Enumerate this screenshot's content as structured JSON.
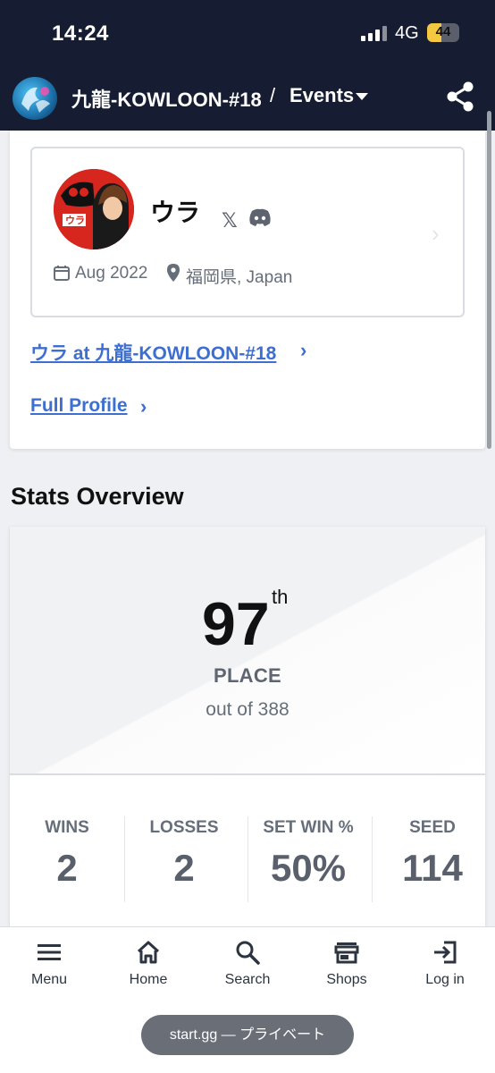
{
  "status_bar": {
    "time": "14:24",
    "network": "4G",
    "battery": "44",
    "battery_level": 0.44
  },
  "nav": {
    "title": "九龍-KOWLOON-#18",
    "separator": "/",
    "section": "Events"
  },
  "profile": {
    "name": "ウラ",
    "social": {
      "x": "𝕏"
    },
    "since": "Aug 2022",
    "location": "福岡県, Japan",
    "event_link": "ウラ at 九龍-KOWLOON-#18",
    "full_profile_link": "Full Profile",
    "chevron": "›"
  },
  "stats": {
    "heading": "Stats Overview",
    "place": "97",
    "place_suffix": "th",
    "place_label": "PLACE",
    "out_of": "out of 388",
    "columns": [
      {
        "label": "WINS",
        "value": "2"
      },
      {
        "label": "LOSSES",
        "value": "2"
      },
      {
        "label": "SET WIN %",
        "value": "50%"
      },
      {
        "label": "SEED",
        "value": "114"
      }
    ]
  },
  "bottom_nav": [
    {
      "label": "Menu",
      "icon": "menu-icon"
    },
    {
      "label": "Home",
      "icon": "home-icon"
    },
    {
      "label": "Search",
      "icon": "search-icon"
    },
    {
      "label": "Shops",
      "icon": "shop-icon"
    },
    {
      "label": "Log in",
      "icon": "login-icon"
    }
  ],
  "url_bar": {
    "text": "start.gg — プライベート"
  },
  "colors": {
    "nav_bg": "#161d33",
    "link": "#3c6fd1",
    "battery": "#f5c842"
  }
}
